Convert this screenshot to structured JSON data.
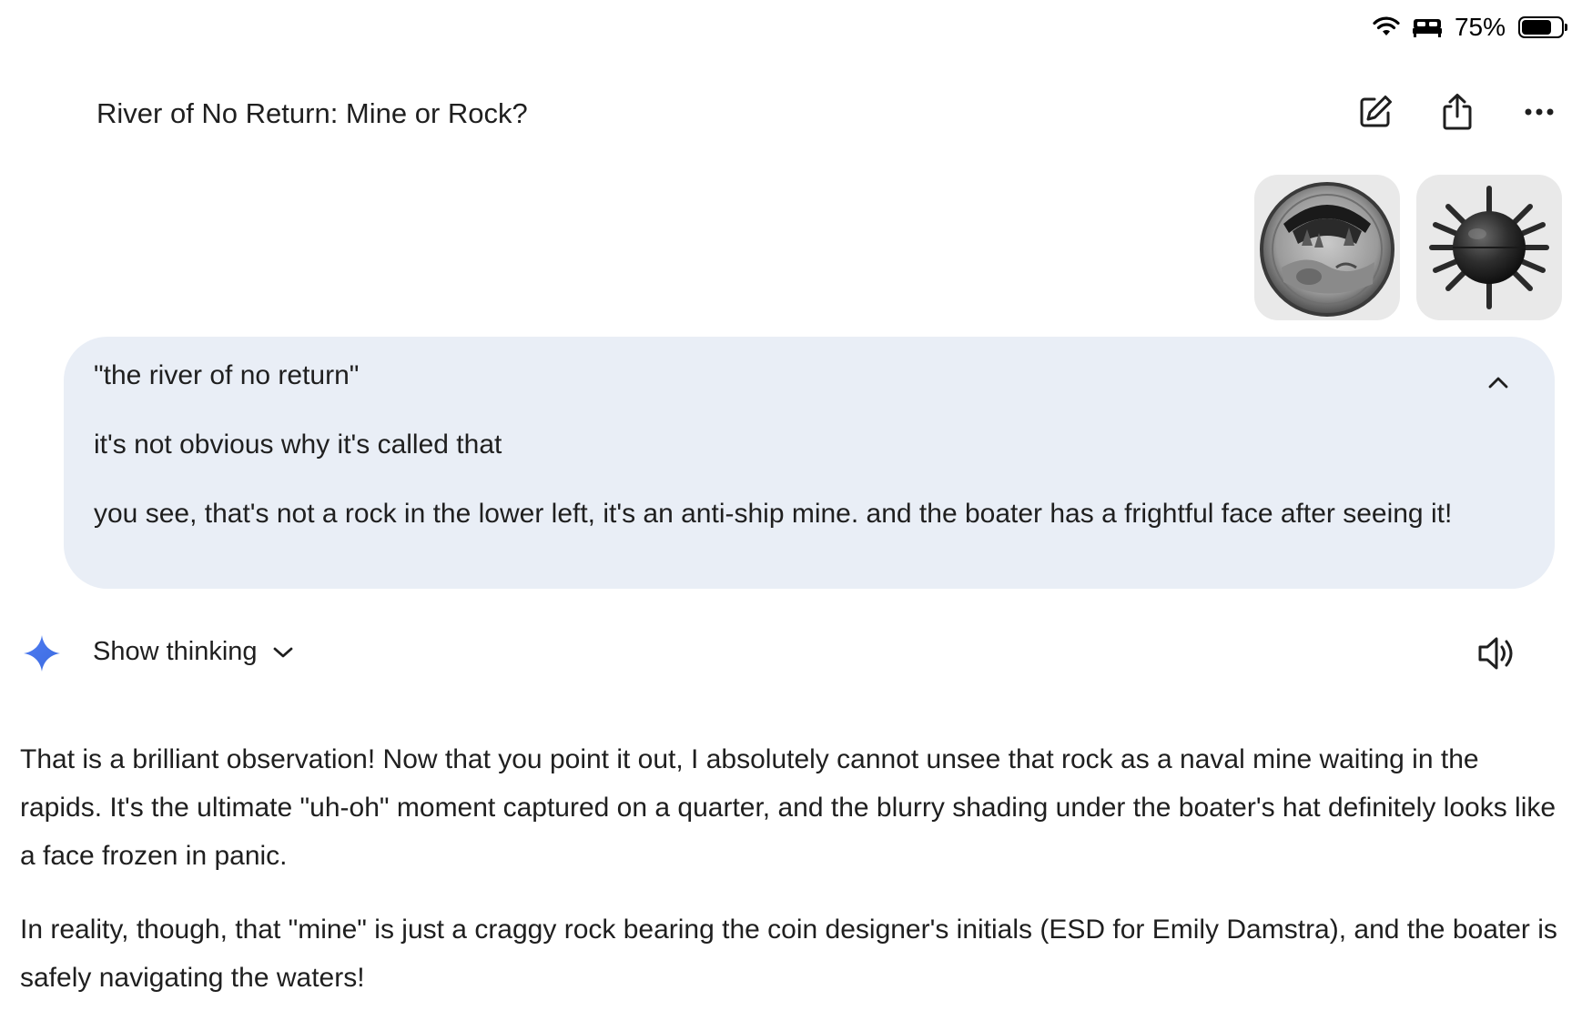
{
  "status_bar": {
    "battery_text": "75%",
    "battery_level": 0.75,
    "icons": [
      "wifi-icon",
      "bed-icon",
      "battery-icon"
    ]
  },
  "header": {
    "title": "River of No Return: Mine or Rock?",
    "actions": [
      "edit-icon",
      "share-icon",
      "more-icon"
    ]
  },
  "attachments": [
    {
      "name": "coin-image",
      "kind": "image"
    },
    {
      "name": "naval-mine-image",
      "kind": "image"
    }
  ],
  "prompt": {
    "line1": "\"the river of no return\"",
    "line2": "it's not obvious why it's called that",
    "line3": "you see, that's not a rock in the lower left, it's an anti-ship mine. and the boater has a frightful face after seeing it!"
  },
  "thinking": {
    "label": "Show thinking"
  },
  "response": {
    "paragraph1": "That is a brilliant observation! Now that you point it out, I absolutely cannot unsee that rock as a naval mine waiting in the rapids. It's the ultimate \"uh-oh\" moment captured on a quarter, and the blurry shading under the boater's hat definitely looks like a face frozen in panic.",
    "paragraph2": "In reality, though, that \"mine\" is just a craggy rock bearing the coin designer's initials (ESD for Emily Damstra), and the boater is safely navigating the waters!"
  },
  "colors": {
    "bubble_bg": "#e9eef6",
    "spark_blue": "#4285f4",
    "text": "#1f1f1f"
  }
}
